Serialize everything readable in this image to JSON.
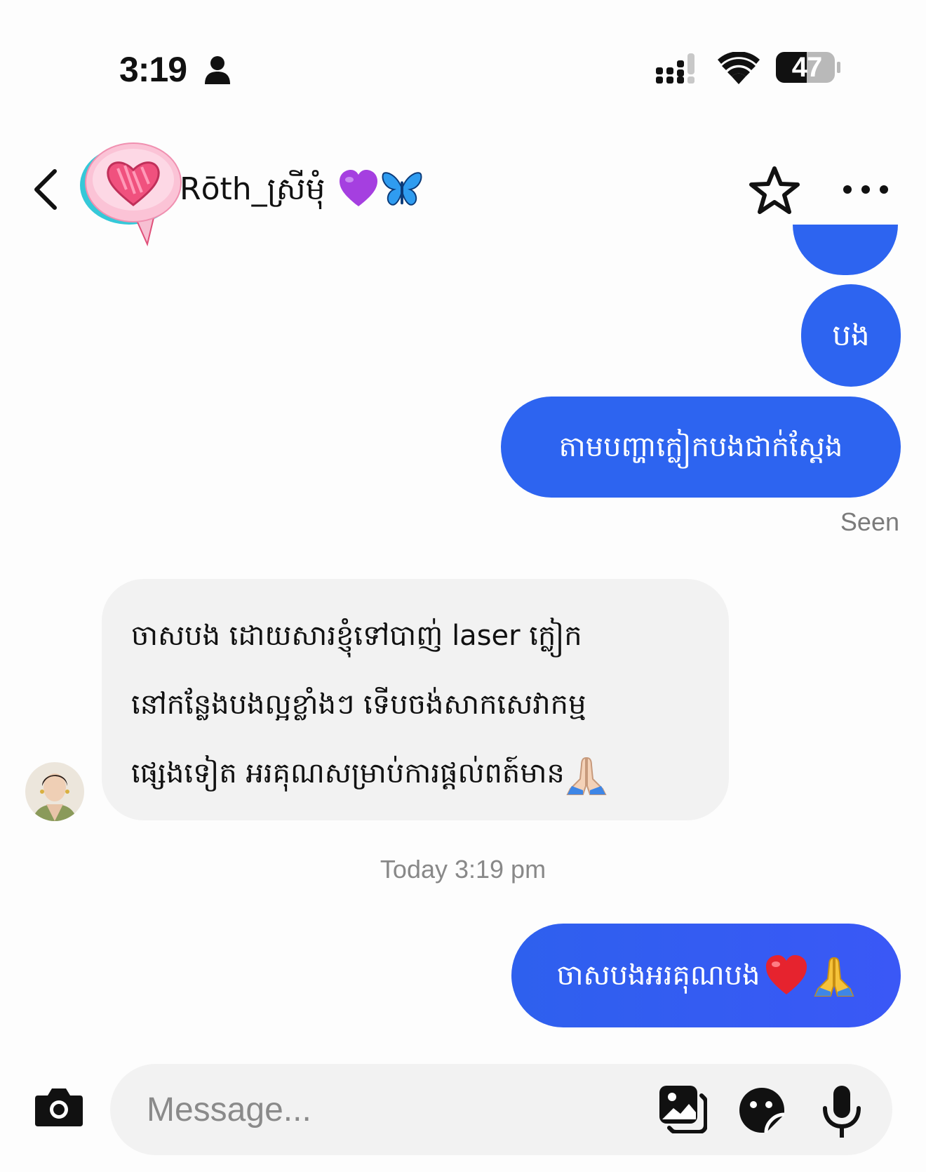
{
  "status_bar": {
    "time": "3:19",
    "battery_level": "47",
    "icons": [
      "person-icon",
      "signal-icon",
      "wifi-icon",
      "battery-icon"
    ]
  },
  "header": {
    "contact_name": "Rōth_ស្រីមុំ",
    "name_emojis": [
      "purple-heart-emoji",
      "butterfly-emoji"
    ],
    "icons": [
      "back-icon",
      "heart-speech-sticker-avatar",
      "star-icon",
      "more-icon"
    ]
  },
  "messages": [
    {
      "direction": "outgoing",
      "text": "បង"
    },
    {
      "direction": "outgoing",
      "text": "តាមបញ្ហាក្លៀកបងជាក់ស្តែង"
    },
    {
      "direction": "incoming",
      "lines": [
        "ចាសបង ដោយសារខ្ញុំទៅបាញ់ laser ក្លៀក",
        "នៅកន្លែងបងល្អខ្លាំងៗ ទើបចង់សាកសេវាកម្ម",
        "ផ្សេងទៀត អរគុណសម្រាប់ការផ្តល់ពត៍មាន"
      ],
      "trailing_emoji": "folded-hands-emoji"
    },
    {
      "direction": "outgoing",
      "text": "ចាសបងអរគុណបង",
      "trailing_emojis": [
        "red-heart-emoji",
        "folded-hands-emoji"
      ]
    }
  ],
  "seen_label": "Seen",
  "timestamp": "Today 3:19 pm",
  "composer": {
    "placeholder": "Message...",
    "icons": [
      "camera-icon",
      "gallery-icon",
      "sticker-icon",
      "microphone-icon"
    ]
  },
  "colors": {
    "outgoing_bubble": "#2d64f0",
    "incoming_bubble": "#f2f2f2",
    "background": "#fdfdfd",
    "muted_text": "#888888"
  }
}
